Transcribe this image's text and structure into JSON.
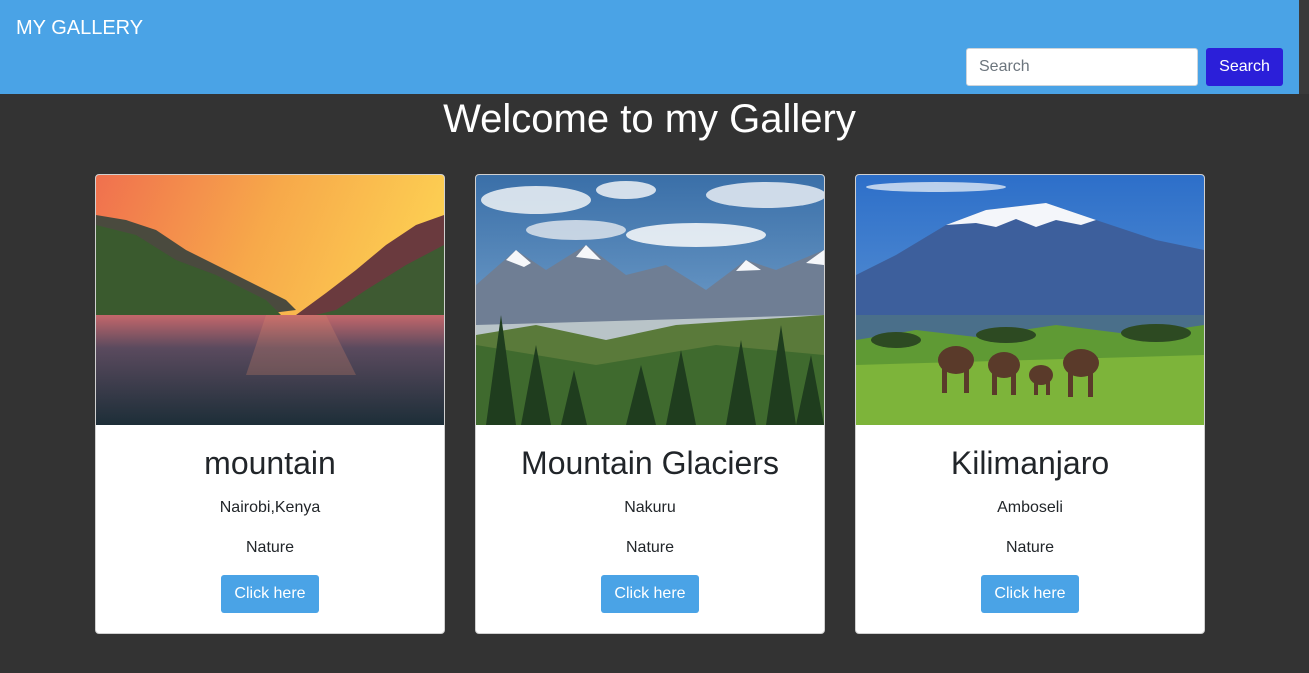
{
  "navbar": {
    "brand": "MY GALLERY",
    "search_placeholder": "Search",
    "search_button": "Search"
  },
  "page": {
    "heading": "Welcome to my Gallery"
  },
  "cards": [
    {
      "title": "mountain",
      "location": "Nairobi,Kenya",
      "category": "Nature",
      "button": "Click here"
    },
    {
      "title": "Mountain Glaciers",
      "location": "Nakuru",
      "category": "Nature",
      "button": "Click here"
    },
    {
      "title": "Kilimanjaro",
      "location": "Amboseli",
      "category": "Nature",
      "button": "Click here"
    }
  ],
  "colors": {
    "navbar": "#4aa3e6",
    "background": "#333333",
    "search_button": "#2b1fd9",
    "card_button": "#4aa3e6"
  }
}
